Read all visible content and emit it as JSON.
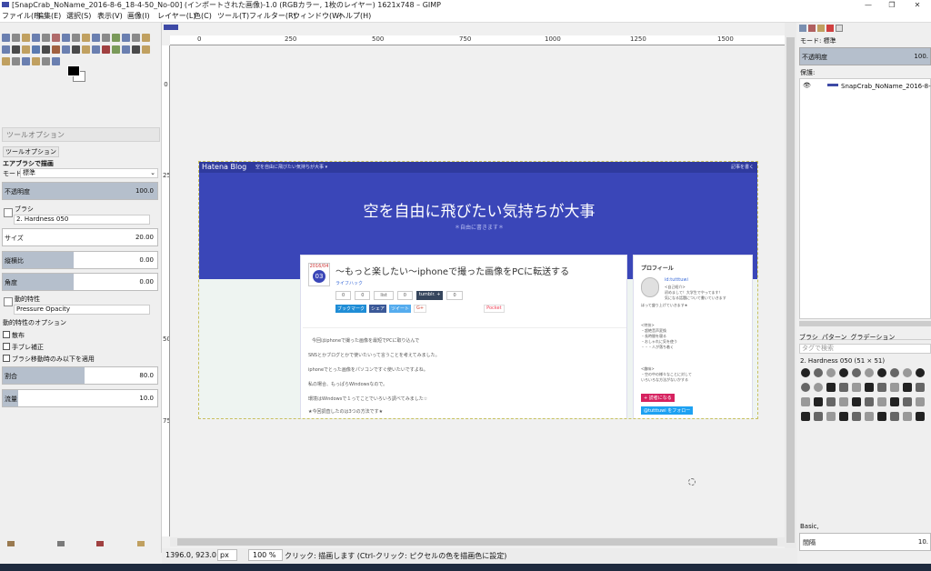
{
  "window": {
    "title": "[SnapCrab_NoName_2016-8-6_18-4-50_No-00] (インポートされた画像)-1.0 (RGBカラー, 1枚のレイヤー) 1621x748 – GIMP",
    "minimize": "—",
    "maximize": "❐",
    "close": "✕"
  },
  "menu": [
    "ファイル(F)",
    "編集(E)",
    "選択(S)",
    "表示(V)",
    "画像(I)",
    "レイヤー(L)",
    "色(C)",
    "ツール(T)",
    "フィルター(R)",
    "ウィンドウ(W)",
    "ヘルプ(H)"
  ],
  "toolbox": {
    "rows": [
      [
        "#6a7fb0",
        "#8a8a8a",
        "#c0a060",
        "#6a7fb0",
        "#8a8a8a",
        "#b06a6a",
        "#6a7fb0",
        "#8a8a8a",
        "#c0a060",
        "#6a7fb0",
        "#8a8a8a",
        "#7a9a5a",
        "#6a7fb0",
        "#8a8a8a",
        "#c0a060"
      ],
      [
        "#6a7fb0",
        "#4a4a4a",
        "#c0a060",
        "#5a7ab0",
        "#4a4a4a",
        "#a06040",
        "#6a7fb0",
        "#4a4a4a",
        "#c0a060",
        "#6a7fb0",
        "#a04040",
        "#7a9a5a",
        "#6a7fb0",
        "#4a4a4a",
        "#c0a060"
      ],
      [
        "#c0a060",
        "#8a8a8a",
        "#6a7fb0",
        "#c0a060",
        "#8a8a8a",
        "#6a7fb0"
      ]
    ],
    "fg_color": "#000000",
    "bg_color": "#ffffff"
  },
  "tool_options": {
    "panel_title": "ツールオプション",
    "tab_label": "ツールオプション",
    "tool_name": "エアブラシで描画",
    "mode_label": "モード",
    "mode_value": "標準",
    "opacity_label": "不透明度",
    "opacity_value": "100.0",
    "opacity_fraction": 1.0,
    "brush_label": "ブラシ",
    "brush_value": "2. Hardness 050",
    "size_label": "サイズ",
    "size_value": "20.00",
    "size_fraction": 0.0,
    "aspect_label": "縦横比",
    "aspect_value": "0.00",
    "aspect_fraction": 0.46,
    "angle_label": "角度",
    "angle_value": "0.00",
    "angle_fraction": 0.46,
    "dynamics_label": "動的特性",
    "dynamics_value": "Pressure Opacity",
    "dynamics_options": "動的特性のオプション",
    "scatter": "散布",
    "smooth": "手ブレ補正",
    "incremental": "ブラシ移動時のみ以下を適用",
    "rate_label": "割合",
    "rate_value": "80.0",
    "rate_fraction": 0.53,
    "flow_label": "流量",
    "flow_value": "10.0",
    "flow_fraction": 0.1
  },
  "ruler": {
    "h_labels": [
      "0",
      "250",
      "500",
      "750",
      "1000",
      "1250",
      "1500"
    ],
    "v_labels": [
      "0",
      "250",
      "500",
      "750"
    ]
  },
  "blog": {
    "logo": "Hatena Blog",
    "nav_subtitle": "空を自由に飛びたい気持ちが大事 ▾",
    "nav_right": "記事を書く",
    "title": "空を自由に飛びたい気持ちが大事",
    "subtitle": "＊自由に書きます＊",
    "date_year": "2016/04",
    "date_day": "03",
    "post_title": "〜もっと楽したい〜iphoneで撮った画像をPCに転送する",
    "category": "ライフハック",
    "share_counts": [
      "0",
      "0",
      "list",
      "0",
      "0"
    ],
    "tumblr": "tumblr. +",
    "share_buttons": [
      "ブックマーク",
      "シェア",
      "ツイート",
      "G+",
      "Pocket"
    ],
    "body": [
      "今回はiphoneで撮った画像を最短でPCに取り込んで",
      "SNSとかブログとかで使いたいって言うことを考えてみました。",
      "iphoneでとった画像をパソコンですぐ使いたいですよね。",
      "私の場合、もっぱらWindowsなので。",
      "環境はWindowsで１ってことでいろいろ調べてみました☆",
      "★今回調査したのは3つの方法です★"
    ],
    "sidebar_title": "プロフィール",
    "profile_name": "id:tutttuwi",
    "profile_lines": [
      "<自己紹介>",
      "初めまして！大学生でやってます！",
      "気になる話題について書いていきます",
      "ほって盛り上げていきます★"
    ],
    "features": [
      "<特技>",
      "・超絶音声変換",
      "・長時間を寝る",
      "・おしゃれに気を使う",
      "・・・人が落ち着く"
    ],
    "hobby": [
      "<趣味>",
      "・空の中の様々なことに対して",
      "いろいろな方法がないかする"
    ],
    "reader_button": "+ 読者になる",
    "follow_button": "@tutttuwi をフォロー"
  },
  "status": {
    "coords": "1396.0, 923.0",
    "unit": "px",
    "zoom": "100 %",
    "message": "クリック: 描画します (Ctrl-クリック: ピクセルの色を描画色に設定)"
  },
  "layers": {
    "mode_label": "モード: 標準",
    "opacity_label": "不透明度",
    "opacity_value": "100.",
    "lock_label": "保護:",
    "layer_name": "SnapCrab_NoName_2016-8-6"
  },
  "brushes": {
    "tabs": [
      "ブラシ",
      "パターン",
      "グラデーション"
    ],
    "filter_placeholder": "タグで検索",
    "current": "2. Hardness 050 (51 × 51)",
    "preset": "Basic,",
    "spacing_label": "間隔",
    "spacing_value": "10."
  }
}
